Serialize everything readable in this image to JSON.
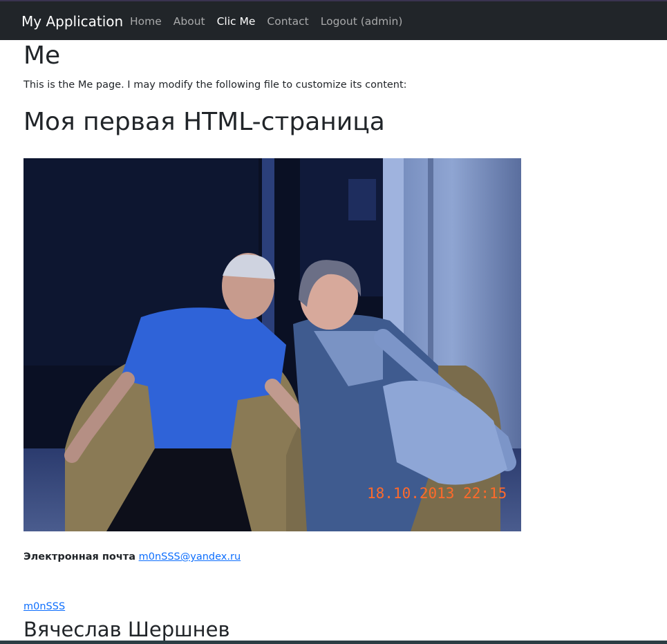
{
  "navbar": {
    "brand": "My Application",
    "items": [
      {
        "label": "Home",
        "active": false
      },
      {
        "label": "About",
        "active": false
      },
      {
        "label": "Clic Me",
        "active": true
      },
      {
        "label": "Contact",
        "active": false
      },
      {
        "label": "Logout (admin)",
        "active": false
      }
    ]
  },
  "page": {
    "title": "Me",
    "intro": "This is the Me page. I may modify the following file to customize its content:",
    "heading": "Моя первая HTML-страница",
    "photo": {
      "description": "photo-of-couple-in-wicker-chairs",
      "timestamp": "18.10.2013 22:15"
    },
    "email_label": "Электронная почта",
    "email": "m0nSSS@yandex.ru",
    "username": "m0nSSS",
    "full_name": "Вячеслав Шершнев"
  },
  "colors": {
    "navbar_bg": "#212529",
    "link": "#0d6efd",
    "timestamp": "#ff6a2b"
  }
}
